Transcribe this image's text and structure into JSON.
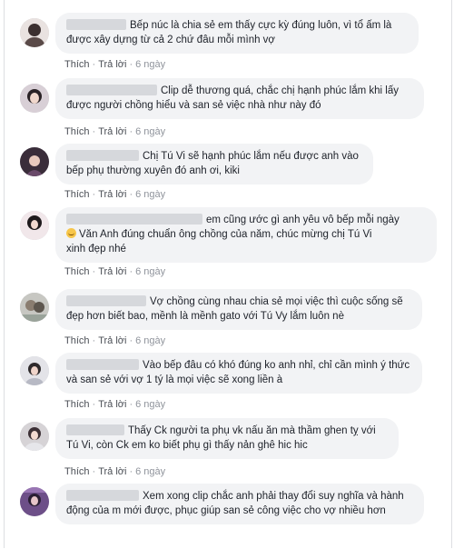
{
  "actions": {
    "like": "Thích",
    "reply": "Trả lời",
    "dot": "·"
  },
  "comments": [
    {
      "text": "Bếp núc là chia sẻ em thấy cực kỳ đúng luôn, vì tổ ấm là được xây dựng từ cả 2 chứ đâu mỗi mình vợ",
      "time": "6 ngày"
    },
    {
      "text": "Clip dễ thương quá, chắc chị hạnh phúc lắm khi lấy được người chồng hiểu và san sẻ việc nhà như này đó",
      "time": "6 ngày"
    },
    {
      "text": "Chị Tú Vi sẽ hạnh phúc lắm nếu được anh vào bếp phụ thường xuyên đó anh ơi, kiki",
      "time": "6 ngày"
    },
    {
      "text_line1": "em cũng ước gì anh yêu vô bếp mỗi ngày",
      "text_line2": "Văn Anh đúng chuẩn ông chồng của năm, chúc mừng chị Tú Vi",
      "text_line3": "xinh đẹp nhé",
      "time": "6 ngày"
    },
    {
      "text": "Vợ chồng cùng nhau chia sẻ mọi việc thì cuộc sống sẽ đẹp hơn biết bao, mềnh là mềnh gato với Tú Vy lắm luôn nè",
      "time": "6 ngày"
    },
    {
      "text": "Vào bếp đâu có khó đúng ko anh nhỉ, chỉ cần mình ý thức và san sẻ với vợ 1 tý là mọi việc sẽ xong liền à",
      "time": "6 ngày"
    },
    {
      "text": "Thấy Ck người ta phụ vk nấu ăn mà thầm ghen tỵ với Tú Vi, còn Ck em ko biết phụ gì thấy nản ghê hic hic",
      "time": "6 ngày"
    },
    {
      "text": "Xem xong clip chắc anh phải thay đổi suy nghĩa và hành động của m mới được, phục giúp san sẻ công việc cho vợ nhiều hơn",
      "time": ""
    }
  ],
  "colors": {
    "bubble": "#f2f3f5",
    "link": "#4b4f56",
    "muted": "#90949c",
    "text": "#1d2129"
  }
}
